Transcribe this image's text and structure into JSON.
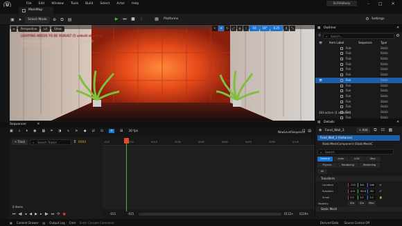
{
  "app": {
    "logo_glyph": "U",
    "menu": [
      "File",
      "Edit",
      "Window",
      "Tools",
      "Build",
      "Select",
      "Actor",
      "Help"
    ],
    "project_name": "SciFiHallway",
    "level_tab": "MainMap"
  },
  "toolbar": {
    "select_mode": "Select Mode",
    "platforms": "Platforms",
    "settings": "Settings"
  },
  "viewport": {
    "perspective": "Perspective",
    "lit": "Lit",
    "show": "Show",
    "warning_1": "LIGHTING NEEDS TO BE REBUILT (5 unbuilt object(s))",
    "warning_2": "Reflection Captures NEED TO BE REBUILT (3 unbuilt)",
    "warning_3": "DisableAllScreenMessages to suppress",
    "grid_snap": "10",
    "rot_snap": "10°",
    "scale_snap": "0.25",
    "cam_speed": "4"
  },
  "outliner": {
    "title": "Outliner",
    "search_placeholder": "Search...",
    "col_label": "Item Label",
    "col_type": "Type",
    "col_seq": "Sequence",
    "rows": [
      {
        "name": "Folc",
        "type": "Static"
      },
      {
        "name": "Folc",
        "type": "Static"
      },
      {
        "name": "Folc",
        "type": "Static"
      },
      {
        "name": "Folc",
        "type": "Static"
      },
      {
        "name": "Fon",
        "type": "Static"
      },
      {
        "name": "Fon",
        "type": "Static"
      },
      {
        "name": "Fon",
        "type": "Static"
      },
      {
        "name": "Fon",
        "type": "Static"
      },
      {
        "name": "Fon",
        "type": "Static"
      },
      {
        "name": "Fon",
        "type": "Static"
      },
      {
        "name": "Fon",
        "type": "Static"
      },
      {
        "name": "Fon",
        "type": "Static"
      },
      {
        "name": "Fon",
        "type": "Static"
      },
      {
        "name": "Fon",
        "type": "Static"
      },
      {
        "name": "Fuse",
        "type": "Static"
      },
      {
        "name": "Fuse",
        "type": "Static"
      }
    ],
    "selected_index": 6,
    "footer": "393 actors (1 selected)"
  },
  "sequencer": {
    "title": "Sequencer",
    "fps": "30 fps",
    "sequence_name": "NewLevelSequence",
    "add_track": "+ Track",
    "search_placeholder": "Search Tracks",
    "current_frame": "0000",
    "ruler": [
      "-015",
      "0000",
      "0015",
      "0030",
      "0045",
      "0060",
      "0075",
      "0090",
      "0105"
    ],
    "items_count": "0 items",
    "start_left": "-015",
    "start_right": "-015",
    "end_left": "0112+",
    "end_right": "0229+"
  },
  "details": {
    "title": "Details",
    "actor_name": "Fond_Wall_3",
    "add_label": "+ Add",
    "instance_label": "Fond_Wall_3 (Instance)",
    "component_label": "StaticMeshComponent (StaticMeshC",
    "search_placeholder": "Search",
    "chips_row1": [
      "General",
      "Actor",
      "LOD",
      "Misc"
    ],
    "chips_row2": [
      "Physics",
      "Rendering",
      "Streaming"
    ],
    "chip_all": "All",
    "section_transform": "Transform",
    "location_label": "Location",
    "location": [
      "-715",
      "341",
      "146"
    ],
    "rotation_label": "Rotation",
    "rotation": [
      "-0.0",
      "-90.0",
      "-90"
    ],
    "scale_label": "Scale",
    "scale": [
      "1.0",
      "1.0",
      "1.0"
    ],
    "mobility_label": "Mobility",
    "mobility": [
      "Sta",
      "Sta",
      "Mov"
    ],
    "section_mesh": "Static Mesh"
  },
  "statusbar": {
    "content_drawer": "Content Drawer",
    "output_log": "Output Log",
    "cmd": "Cmd",
    "console_placeholder": "Enter Console Command",
    "derived_data": "Derived Data",
    "source_control": "Source Control Off"
  }
}
